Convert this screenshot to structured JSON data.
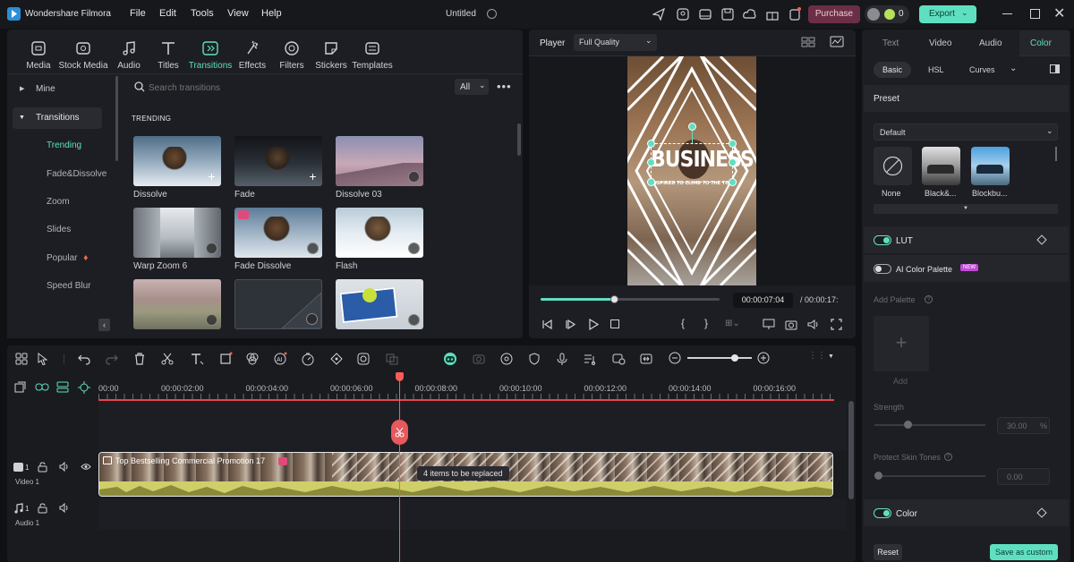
{
  "app": {
    "name": "Wondershare Filmora",
    "project_title": "Untitled"
  },
  "menu": [
    "File",
    "Edit",
    "Tools",
    "View",
    "Help"
  ],
  "titlebar": {
    "purchase_label": "Purchase",
    "credits": "0",
    "export_label": "Export"
  },
  "toolbar_tabs": [
    "Media",
    "Stock Media",
    "Audio",
    "Titles",
    "Transitions",
    "Effects",
    "Filters",
    "Stickers",
    "Templates"
  ],
  "sidebar": {
    "mine": "Mine",
    "transitions": "Transitions",
    "items": [
      "Trending",
      "Fade&Dissolve",
      "Zoom",
      "Slides",
      "Popular",
      "Speed Blur"
    ]
  },
  "browser": {
    "search_placeholder": "Search transitions",
    "filter": "All",
    "section": "TRENDING",
    "items": [
      "Dissolve",
      "Fade",
      "Dissolve 03",
      "Warp Zoom 6",
      "Fade Dissolve",
      "Flash",
      "",
      "",
      ""
    ]
  },
  "player": {
    "label": "Player",
    "quality": "Full Quality",
    "current_time": "00:00:07:04",
    "total_time": "/ 00:00:17:",
    "progress": 0.41,
    "title_text": "BUSINESS",
    "subtitle_text": "INSPIRED TO CLIMB TO THE TOP"
  },
  "timeline": {
    "ruler": [
      "00:00",
      "00:00:02:00",
      "00:00:04:00",
      "00:00:06:00",
      "00:00:08:00",
      "00:00:10:00",
      "00:00:12:00",
      "00:00:14:00",
      "00:00:16:00"
    ],
    "clip_title": "Top Bestselling Commercial Promotion 17",
    "replace_tooltip": "4 items to be replaced",
    "tracks": [
      {
        "num": "1",
        "label": "Video 1"
      },
      {
        "num": "1",
        "label": "Audio 1"
      }
    ],
    "zoom_level": 0.74
  },
  "right_panel": {
    "tabs": [
      "Text",
      "Video",
      "Audio",
      "Color"
    ],
    "subtabs": [
      "Basic",
      "HSL",
      "Curves"
    ],
    "preset_title": "Preset",
    "preset_dropdown": "Default",
    "presets": [
      "None",
      "Black&...",
      "Blockbu..."
    ],
    "lut_label": "LUT",
    "ai_palette_label": "AI Color Palette",
    "new_badge": "NEW",
    "add_palette_label": "Add Palette",
    "add_label": "Add",
    "strength_label": "Strength",
    "strength_value": "30.00",
    "strength_unit": "%",
    "strength_level": 0.3,
    "protect_label": "Protect Skin Tones",
    "protect_value": "0.00",
    "color_label": "Color",
    "reset_label": "Reset",
    "save_custom_label": "Save as custom"
  },
  "colors": {
    "accent": "#5ee0c0",
    "playhead": "#ff5a5a",
    "purchase": "#6b2f45",
    "export": "#5ee0c0"
  }
}
